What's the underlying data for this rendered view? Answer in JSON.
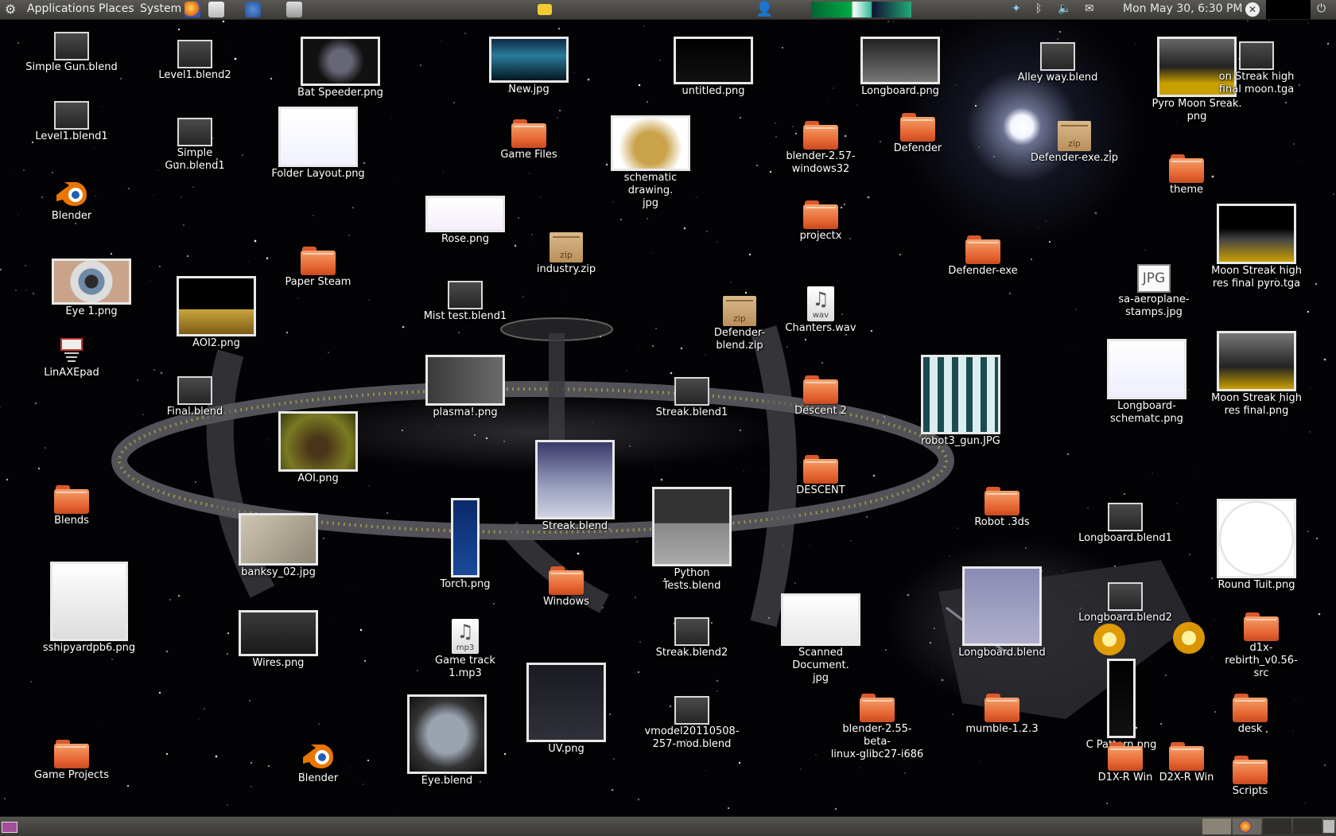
{
  "top_panel": {
    "menus": [
      "Applications",
      "Places",
      "System"
    ],
    "clock": "Mon May 30,  6:30 PM"
  },
  "colors": {
    "folder": "#e4622f",
    "panel": "#3c3b37",
    "label": "#ffffff"
  },
  "icons": [
    {
      "label": "Simple Gun.blend",
      "type": "blend"
    },
    {
      "label": "Level1.blend1",
      "type": "blend"
    },
    {
      "label": "Blender",
      "type": "blender-app"
    },
    {
      "label": "Eye 1.png",
      "type": "thumbnail"
    },
    {
      "label": "LinAXEpad",
      "type": "app"
    },
    {
      "label": "Blends",
      "type": "folder"
    },
    {
      "label": "sshipyardpb6.png",
      "type": "thumbnail"
    },
    {
      "label": "Game Projects",
      "type": "folder"
    },
    {
      "label": "Level1.blend2",
      "type": "blend"
    },
    {
      "label": "Simple Gun.blend1",
      "type": "blend"
    },
    {
      "label": "AOI2.png",
      "type": "thumbnail"
    },
    {
      "label": "Final.blend",
      "type": "blend"
    },
    {
      "label": "banksy_02.jpg",
      "type": "thumbnail"
    },
    {
      "label": "Wires.png",
      "type": "thumbnail"
    },
    {
      "label": "Bat Speeder.png",
      "type": "thumbnail"
    },
    {
      "label": "Folder Layout.png",
      "type": "thumbnail"
    },
    {
      "label": "Paper Steam",
      "type": "folder"
    },
    {
      "label": "AOI.png",
      "type": "thumbnail"
    },
    {
      "label": "Blender",
      "type": "blender-app"
    },
    {
      "label": "Rose.png",
      "type": "thumbnail"
    },
    {
      "label": "Mist test.blend1",
      "type": "blend"
    },
    {
      "label": "plasma!.png",
      "type": "thumbnail"
    },
    {
      "label": "Torch.png",
      "type": "thumbnail"
    },
    {
      "label": "Game track 1.mp3",
      "type": "audio"
    },
    {
      "label": "Eye.blend",
      "type": "thumbnail"
    },
    {
      "label": "New.jpg",
      "type": "thumbnail"
    },
    {
      "label": "Game Files",
      "type": "folder"
    },
    {
      "label": "industry.zip",
      "type": "zip"
    },
    {
      "label": "Streak.blend",
      "type": "thumbnail"
    },
    {
      "label": "Windows",
      "type": "folder"
    },
    {
      "label": "UV.png",
      "type": "thumbnail"
    },
    {
      "label": "untitled.png",
      "type": "thumbnail"
    },
    {
      "label": "schematic drawing.\njpg",
      "type": "thumbnail"
    },
    {
      "label": "Defender-blend.zip",
      "type": "zip"
    },
    {
      "label": "Streak.blend1",
      "type": "blend"
    },
    {
      "label": "Python Tests.blend",
      "type": "thumbnail"
    },
    {
      "label": "Streak.blend2",
      "type": "blend"
    },
    {
      "label": "vmodel20110508-\n257-mod.blend",
      "type": "blend"
    },
    {
      "label": "Longboard.png",
      "type": "thumbnail"
    },
    {
      "label": "blender-2.57-\nwindows32",
      "type": "folder"
    },
    {
      "label": "projectx",
      "type": "folder"
    },
    {
      "label": "Chanters.wav",
      "type": "audio"
    },
    {
      "label": "Descent 2",
      "type": "folder"
    },
    {
      "label": "DESCENT",
      "type": "folder"
    },
    {
      "label": "Scanned Document.\njpg",
      "type": "thumbnail"
    },
    {
      "label": "blender-2.55-beta-\nlinux-glibc27-i686",
      "type": "folder"
    },
    {
      "label": "Defender",
      "type": "folder"
    },
    {
      "label": "Defender-exe",
      "type": "folder"
    },
    {
      "label": "robot3_gun.JPG",
      "type": "thumbnail"
    },
    {
      "label": "Robot .3ds",
      "type": "folder"
    },
    {
      "label": "Longboard.blend",
      "type": "thumbnail"
    },
    {
      "label": "mumble-1.2.3",
      "type": "folder"
    },
    {
      "label": "Alley way.blend",
      "type": "blend"
    },
    {
      "label": "Defender-exe.zip",
      "type": "zip"
    },
    {
      "label": "sa-aeroplane-\nstamps.jpg",
      "type": "jpg"
    },
    {
      "label": "Longboard-\nschematc.png",
      "type": "thumbnail"
    },
    {
      "label": "Longboard.blend1",
      "type": "blend"
    },
    {
      "label": "Longboard.blend2",
      "type": "blend"
    },
    {
      "label": "C Pattern.png",
      "type": "thumbnail"
    },
    {
      "label": "D1X-R Win",
      "type": "folder"
    },
    {
      "label": "Pyro Moon Sreak.\npng",
      "type": "thumbnail"
    },
    {
      "label": "theme",
      "type": "folder"
    },
    {
      "label": "D2X-R Win",
      "type": "folder"
    },
    {
      "label": "on Streak high\nfinal moon.tga",
      "type": "blend"
    },
    {
      "label": "Moon Streak high\nres final pyro.tga",
      "type": "thumbnail"
    },
    {
      "label": "Moon Streak high\nres final.png",
      "type": "thumbnail"
    },
    {
      "label": "Round Tuit.png",
      "type": "thumbnail"
    },
    {
      "label": "d1x-rebirth_v0.56-\nsrc",
      "type": "folder"
    },
    {
      "label": "desk",
      "type": "folder"
    },
    {
      "label": "Scripts",
      "type": "folder"
    }
  ]
}
